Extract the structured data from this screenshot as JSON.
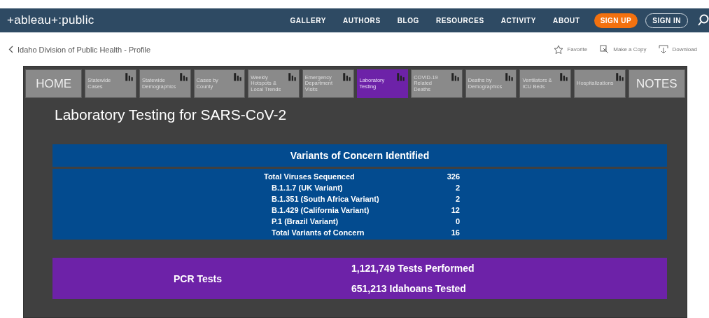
{
  "header": {
    "logo": "+ableau+:public",
    "nav": [
      {
        "label": "GALLERY",
        "kind": "link"
      },
      {
        "label": "AUTHORS",
        "kind": "link"
      },
      {
        "label": "BLOG",
        "kind": "link"
      },
      {
        "label": "RESOURCES",
        "kind": "link"
      },
      {
        "label": "ACTIVITY",
        "kind": "link"
      },
      {
        "label": "ABOUT",
        "kind": "link"
      },
      {
        "label": "SIGN UP",
        "kind": "primary"
      },
      {
        "label": "SIGN IN",
        "kind": "outline"
      }
    ]
  },
  "breadcrumb": "Idaho Division of Public Health - Profile",
  "actions": [
    "Favorite",
    "Make a Copy",
    "Download"
  ],
  "dashboard": {
    "tabs": [
      {
        "label": "HOME",
        "kind": "big",
        "selected": false
      },
      {
        "label": "Statewide Cases",
        "kind": "small",
        "selected": false
      },
      {
        "label": "Statewide Demographics",
        "kind": "small",
        "selected": false
      },
      {
        "label": "Cases by County",
        "kind": "small",
        "selected": false
      },
      {
        "label": "Weekly Hotspots & Local Trends",
        "kind": "small",
        "selected": false
      },
      {
        "label": "Emergency Department Visits",
        "kind": "small",
        "selected": false
      },
      {
        "label": "Laboratory Testing",
        "kind": "small",
        "selected": true
      },
      {
        "label": "COVID-19 Related Deaths",
        "kind": "small",
        "selected": false
      },
      {
        "label": "Deaths by Demographics",
        "kind": "small",
        "selected": false
      },
      {
        "label": "Ventilators & ICU Beds",
        "kind": "small",
        "selected": false
      },
      {
        "label": "Hospitalizations",
        "kind": "small",
        "selected": false
      },
      {
        "label": "NOTES",
        "kind": "big",
        "selected": false
      }
    ],
    "title": "Laboratory Testing for SARS-CoV-2",
    "variants": {
      "title": "Variants of Concern Identified",
      "rows": [
        {
          "label": "Total Viruses Sequenced",
          "value": "326",
          "children": [
            {
              "label": "B.1.1.7 (UK Variant)",
              "value": "2"
            },
            {
              "label": "B.1.351 (South Africa Variant)",
              "value": "2"
            },
            {
              "label": "B.1.429 (California Variant)",
              "value": "12"
            },
            {
              "label": "P.1 (Brazil Variant)",
              "value": "0"
            },
            {
              "label": "Total Variants of Concern",
              "value": "16"
            }
          ]
        }
      ]
    },
    "pcr": {
      "label": "PCR Tests",
      "lines": [
        "1,121,749 Tests Performed",
        "651,213 Idahoans Tested"
      ]
    }
  }
}
